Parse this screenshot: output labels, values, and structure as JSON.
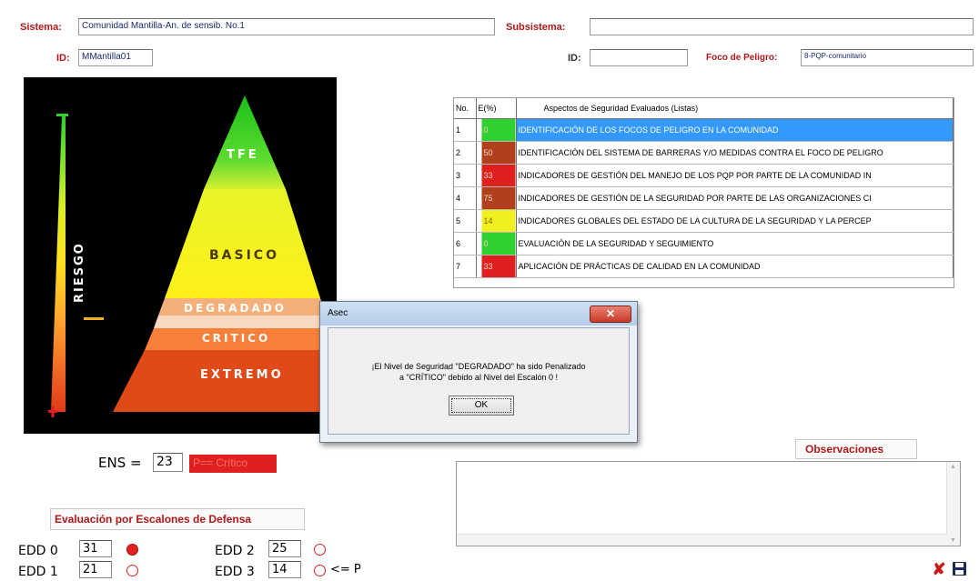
{
  "header": {
    "sistema_label": "Sistema:",
    "sistema_value": "Comunidad Mantilla-An. de sensib. No.1",
    "subsistema_label": "Subsistema:",
    "subsistema_value": "",
    "id_label": "ID:",
    "id_value": "MMantilla01",
    "id2_label": "ID:",
    "id2_value": "",
    "foco_label": "Foco de Peligro:",
    "foco_value": "8-PQP-comunitario"
  },
  "pyramid": {
    "riesgo_label": "RIESGO",
    "levels": [
      "TFE",
      "BASICO",
      "DEGRADADO",
      "CRITICO",
      "EXTREMO"
    ]
  },
  "table": {
    "headers": [
      "No.",
      "E(%)",
      "Aspectos de Seguridad Evaluados (Listas)"
    ],
    "rows": [
      {
        "no": "1",
        "e": "0",
        "color": "#2fd02f",
        "aspecto": "IDENTIFICACIÓN DE LOS FOCOS DE PELIGRO EN LA COMUNIDAD",
        "selected": true
      },
      {
        "no": "2",
        "e": "50",
        "color": "#b0401c",
        "aspecto": "IDENTIFICACIÓN DEL SISTEMA DE BARRERAS Y/O MEDIDAS CONTRA EL FOCO DE PELIGRO",
        "selected": false
      },
      {
        "no": "3",
        "e": "33",
        "color": "#e02020",
        "aspecto": "INDICADORES DE GESTIÓN DEL MANEJO DE LOS PQP POR PARTE DE LA COMUNIDAD IN",
        "selected": false
      },
      {
        "no": "4",
        "e": "75",
        "color": "#b0401c",
        "aspecto": "INDICADORES DE GESTIÓN DE LA SEGURIDAD POR PARTE DE LAS ORGANIZACIONES CI",
        "selected": false
      },
      {
        "no": "5",
        "e": "14",
        "color": "#f0f020",
        "aspecto": "INDICADORES GLOBALES DEL ESTADO DE LA CULTURA DE LA SEGURIDAD Y LA PERCEP",
        "selected": false
      },
      {
        "no": "6",
        "e": "0",
        "color": "#2fd02f",
        "aspecto": "EVALUACIÓN DE LA SEGURIDAD Y SEGUIMIENTO",
        "selected": false
      },
      {
        "no": "7",
        "e": "33",
        "color": "#e02020",
        "aspecto": "APLICACIÓN DE PRÁCTICAS DE CALIDAD EN LA COMUNIDAD",
        "selected": false
      }
    ]
  },
  "dialog": {
    "title": "Asec",
    "message_line1": "¡El Nivel de Seguridad \"DEGRADADO\" ha sido Penalizado",
    "message_line2": "a \"CRÍTICO\" debido al Nivel del Escalón 0 !",
    "ok_label": "OK"
  },
  "ens": {
    "label": "ENS =",
    "value": "23",
    "status": "P== Crítico"
  },
  "observaciones_label": "Observaciones",
  "evaluacion_label": "Evaluación por Escalones de Defensa",
  "edd": [
    {
      "label": "EDD 0",
      "value": "31",
      "filled": true,
      "suffix": ""
    },
    {
      "label": "EDD 1",
      "value": "21",
      "filled": false,
      "suffix": ""
    },
    {
      "label": "EDD 2",
      "value": "25",
      "filled": false,
      "suffix": ""
    },
    {
      "label": "EDD 3",
      "value": "14",
      "filled": false,
      "suffix": "<= P"
    }
  ],
  "colors": {
    "label_red": "#b01818",
    "selection_blue": "#3399ff",
    "status_red": "#e02020"
  }
}
